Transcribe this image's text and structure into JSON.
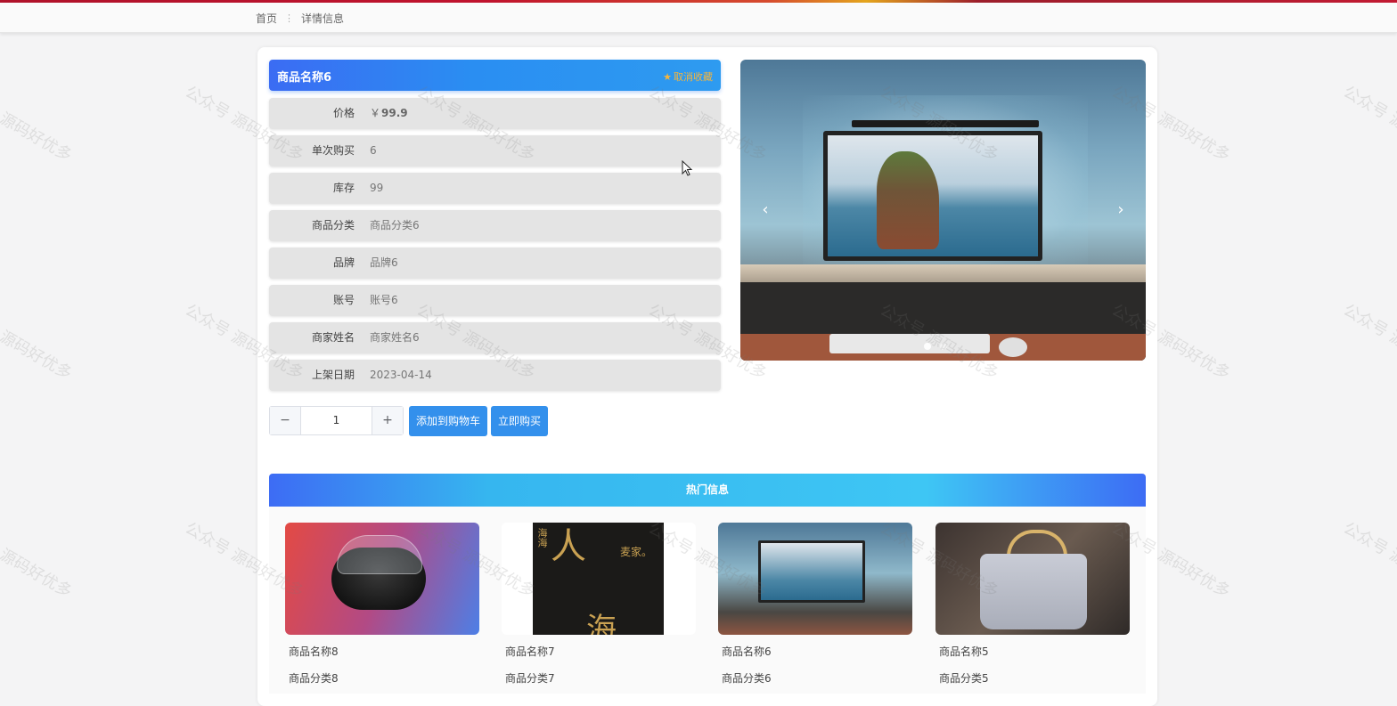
{
  "breadcrumb": {
    "home": "首页",
    "separator": "⋮",
    "current": "详情信息"
  },
  "product": {
    "title": "商品名称6",
    "favorite_label": "取消收藏",
    "favorite_icon": "star-icon",
    "fields": [
      {
        "label": "价格",
        "currency": "￥",
        "value": "99.9"
      },
      {
        "label": "单次购买",
        "value": "6"
      },
      {
        "label": "库存",
        "value": "99"
      },
      {
        "label": "商品分类",
        "value": "商品分类6"
      },
      {
        "label": "品牌",
        "value": "品牌6"
      },
      {
        "label": "账号",
        "value": "账号6"
      },
      {
        "label": "商家姓名",
        "value": "商家姓名6"
      },
      {
        "label": "上架日期",
        "value": "2023-04-14"
      }
    ]
  },
  "purchase": {
    "minus": "−",
    "quantity": "1",
    "plus": "+",
    "add_to_cart": "添加到购物车",
    "buy_now": "立即购买"
  },
  "carousel": {
    "prev": "‹",
    "next": "›",
    "slide_count": 2,
    "active_slide": 1
  },
  "hot": {
    "header": "热门信息",
    "items": [
      {
        "name": "商品名称8",
        "category": "商品分类8"
      },
      {
        "name": "商品名称7",
        "category": "商品分类7"
      },
      {
        "name": "商品名称6",
        "category": "商品分类6"
      },
      {
        "name": "商品名称5",
        "category": "商品分类5"
      }
    ],
    "book_text": {
      "author": "麦家。",
      "title_char": "人",
      "title_char2": "海",
      "side": "海海"
    }
  },
  "watermark": "公众号 源码好优多",
  "colors": {
    "primary_button": "#3390ec",
    "favorite": "#f6b53c",
    "title_gradient_start": "#3b6cf3"
  }
}
